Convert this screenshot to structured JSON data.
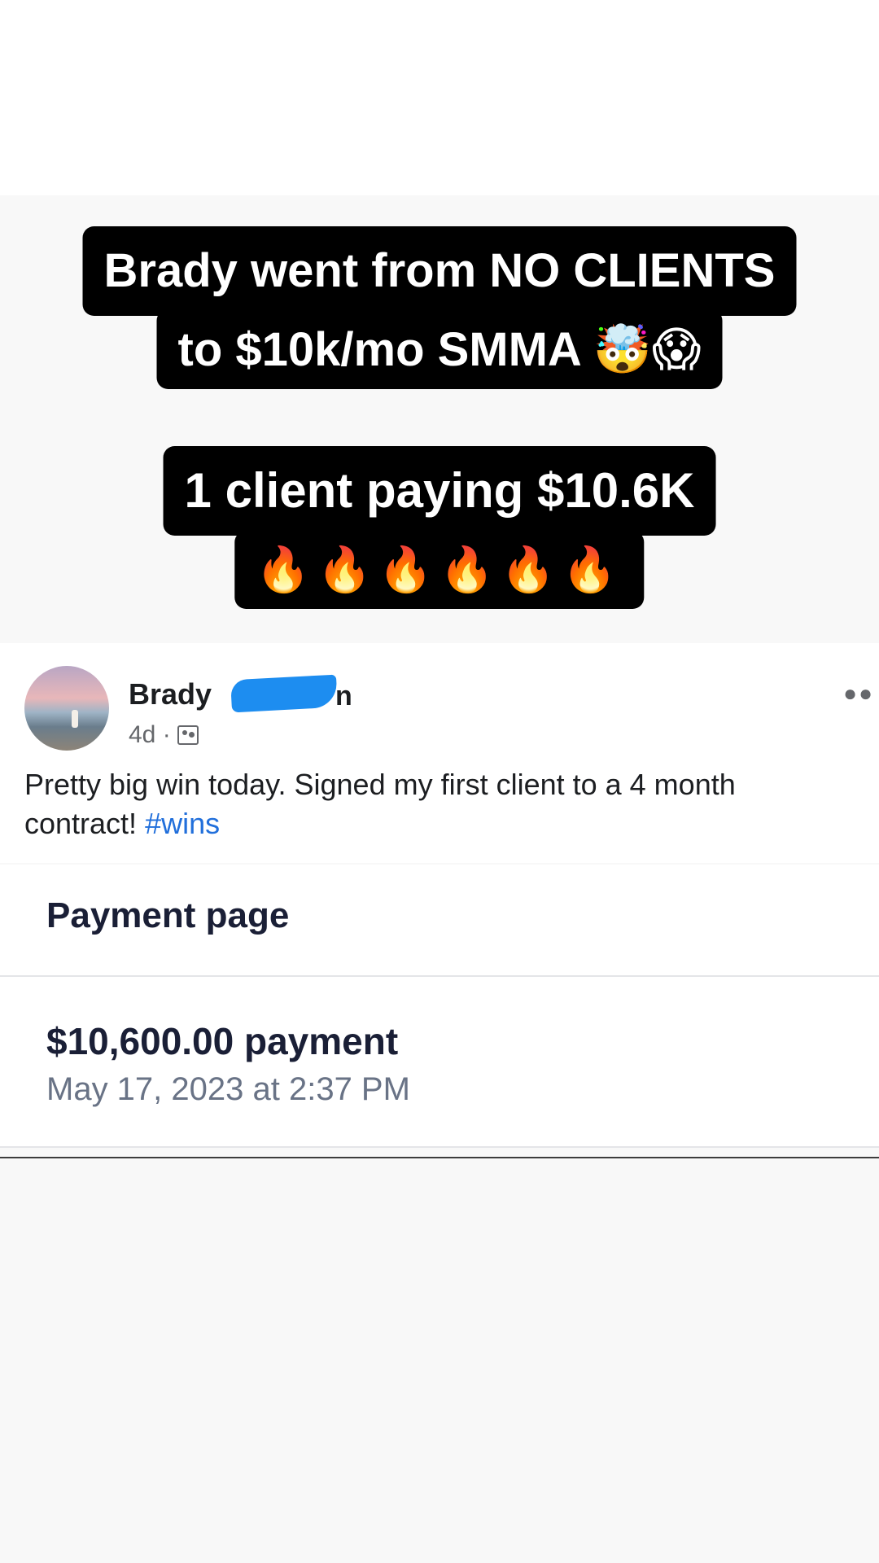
{
  "overlay": {
    "headline_line1": "Brady went from NO CLIENTS",
    "headline_line2": "to $10k/mo SMMA",
    "headline_emojis": "🤯😱",
    "subhead_line1": "1 client paying $10.6K",
    "subhead_emojis": "🔥🔥🔥🔥🔥🔥"
  },
  "post": {
    "author": "Brady",
    "author_suffix": "n",
    "time": "4d",
    "separator": "·",
    "audience_icon": "group-audience-icon",
    "more_icon": "more-options-icon",
    "text": "Pretty big win today. Signed my first client to a 4 month contract! ",
    "hashtag": "#wins"
  },
  "payment": {
    "page_title": "Payment page",
    "amount": "$10,600.00 payment",
    "date": "May 17, 2023 at 2:37 PM"
  },
  "colors": {
    "caption_bg": "#000000",
    "redaction": "#1d8df0",
    "hashtag": "#216fdb"
  }
}
